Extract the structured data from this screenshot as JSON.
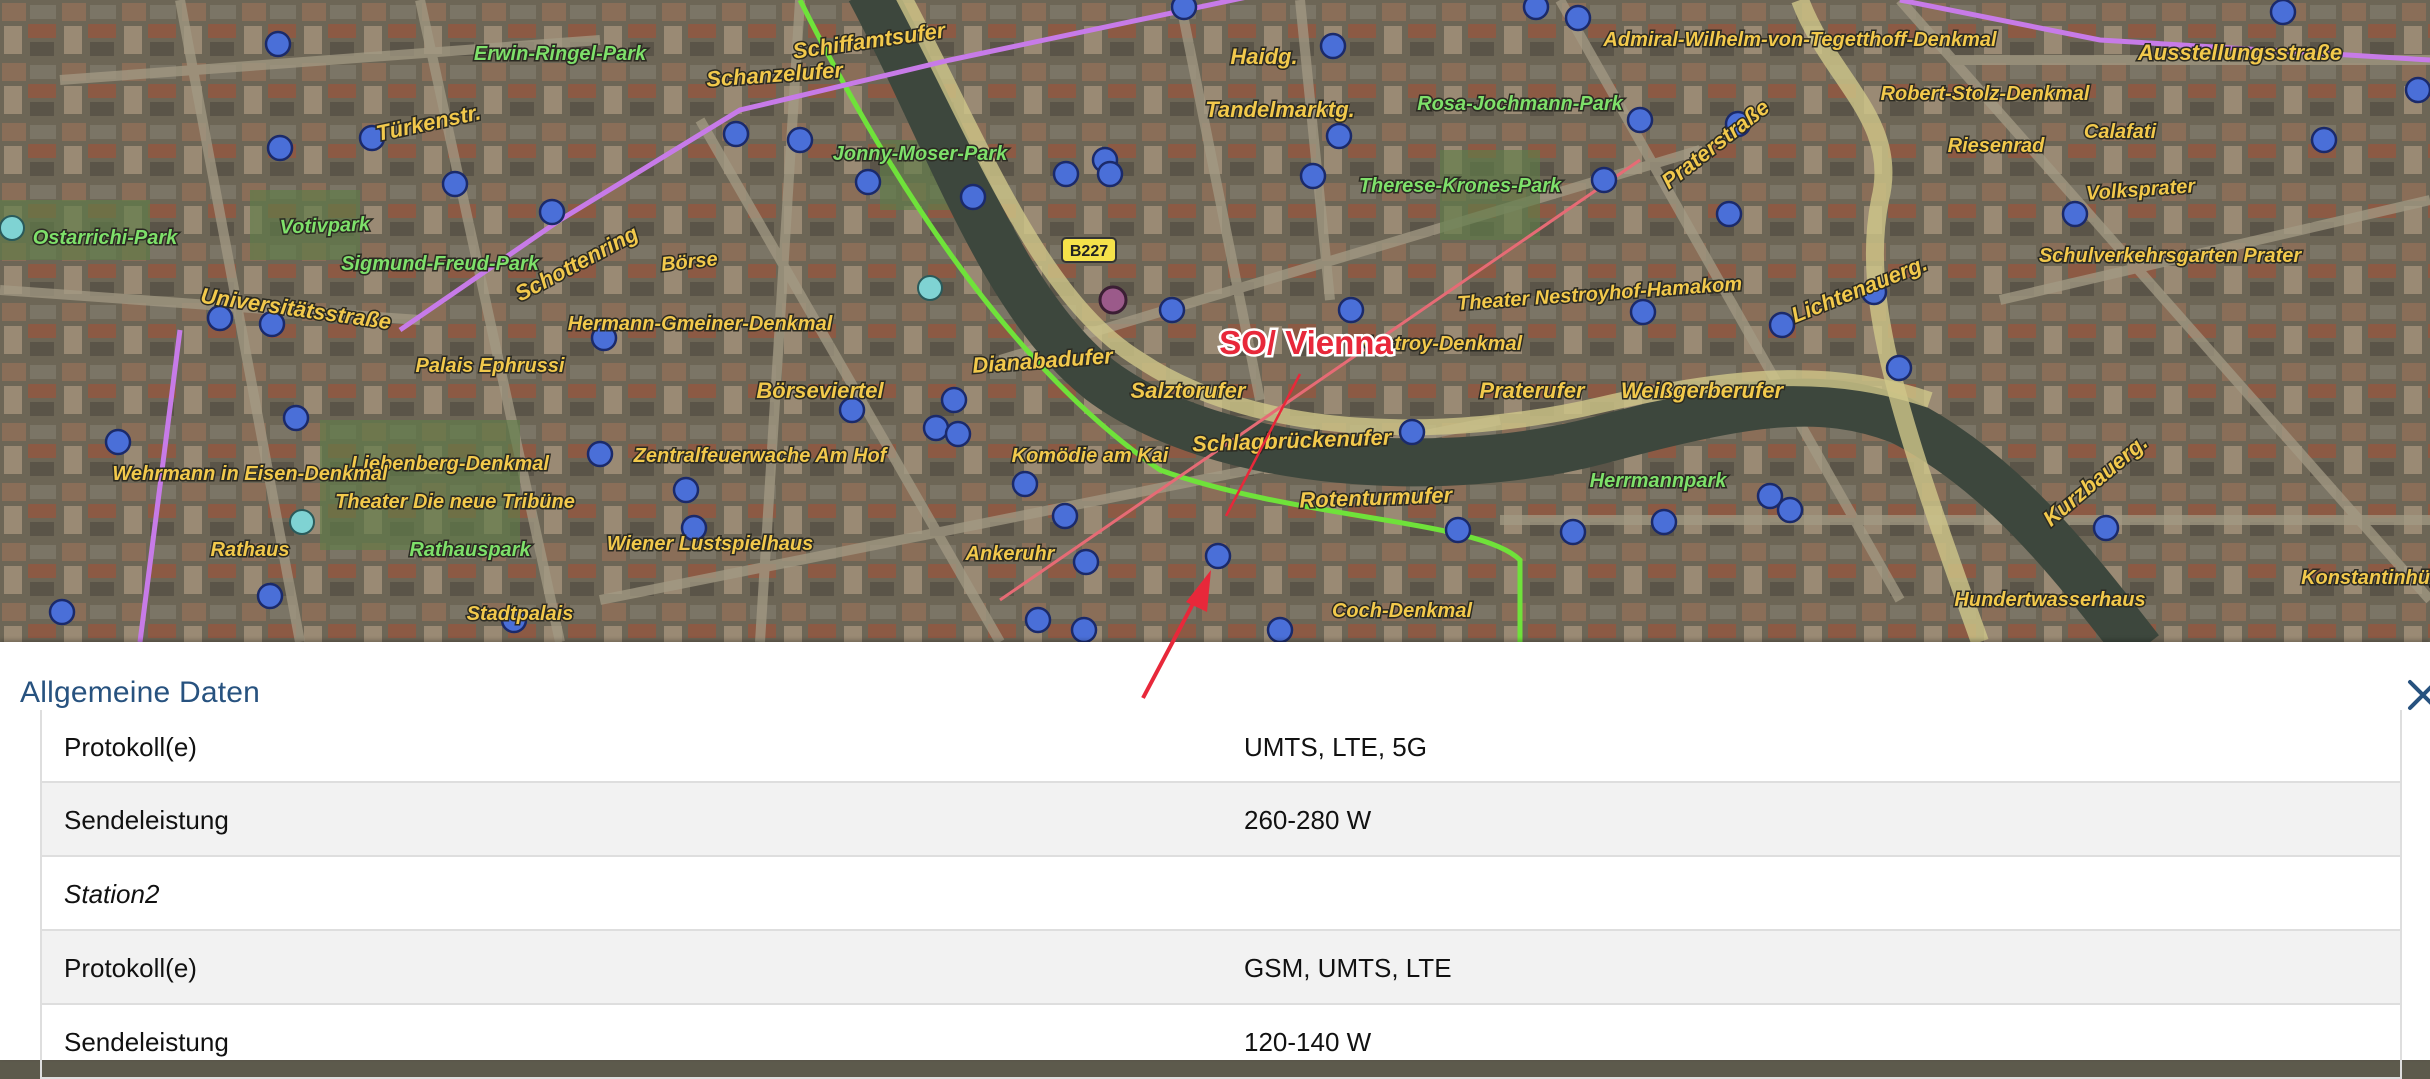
{
  "map": {
    "callout_label": "SO/ Vienna",
    "road_shield": "B227",
    "labels": [
      {
        "text": "Schiffamtsufer",
        "kind": "street"
      },
      {
        "text": "Schanzelufer",
        "kind": "street"
      },
      {
        "text": "Erwin-Ringel-Park",
        "kind": "park"
      },
      {
        "text": "Türkenstr.",
        "kind": "street"
      },
      {
        "text": "Votivpark",
        "kind": "park"
      },
      {
        "text": "Ostarrichi-Park",
        "kind": "park"
      },
      {
        "text": "Universitätsstraße",
        "kind": "street"
      },
      {
        "text": "Sigmund-Freud-Park",
        "kind": "park"
      },
      {
        "text": "Schottenring",
        "kind": "street"
      },
      {
        "text": "Börse",
        "kind": "poi"
      },
      {
        "text": "Hermann-Gmeiner-Denkmal",
        "kind": "poi"
      },
      {
        "text": "Jonny-Moser-Park",
        "kind": "park"
      },
      {
        "text": "Palais Ephrussi",
        "kind": "poi"
      },
      {
        "text": "Liebenberg-Denkmal",
        "kind": "poi"
      },
      {
        "text": "Wehrmann in Eisen-Denkmal",
        "kind": "poi"
      },
      {
        "text": "Theater Die neue Tribüne",
        "kind": "poi"
      },
      {
        "text": "Rathauspark",
        "kind": "park"
      },
      {
        "text": "Rathaus",
        "kind": "poi"
      },
      {
        "text": "Stadtpalais",
        "kind": "poi"
      },
      {
        "text": "Zentralfeuerwache Am Hof",
        "kind": "poi"
      },
      {
        "text": "Wiener Lustspielhaus",
        "kind": "poi"
      },
      {
        "text": "Börseviertel",
        "kind": "street"
      },
      {
        "text": "Dianabadufer",
        "kind": "street"
      },
      {
        "text": "Salztorufer",
        "kind": "street"
      },
      {
        "text": "Komödie am Kai",
        "kind": "poi"
      },
      {
        "text": "Ankeruhr",
        "kind": "poi"
      },
      {
        "text": "Schlagbrückenufer",
        "kind": "street"
      },
      {
        "text": "Rotenturmufer",
        "kind": "street"
      },
      {
        "text": "Coch-Denkmal",
        "kind": "poi"
      },
      {
        "text": "Nestroy-Denkmal",
        "kind": "poi"
      },
      {
        "text": "Tandelmarktg.",
        "kind": "street"
      },
      {
        "text": "Haidg.",
        "kind": "street"
      },
      {
        "text": "Rosa-Jochmann-Park",
        "kind": "park"
      },
      {
        "text": "Therese-Krones-Park",
        "kind": "park"
      },
      {
        "text": "Theater Nestroyhof-Hamakom",
        "kind": "poi"
      },
      {
        "text": "Praterstraße",
        "kind": "street"
      },
      {
        "text": "Praterufer",
        "kind": "street"
      },
      {
        "text": "Weißgerberufer",
        "kind": "street"
      },
      {
        "text": "Herrmannpark",
        "kind": "park"
      },
      {
        "text": "Admiral-Wilhelm-von-Tegetthoff-Denkmal",
        "kind": "poi"
      },
      {
        "text": "Robert-Stolz-Denkmal",
        "kind": "poi"
      },
      {
        "text": "Riesenrad",
        "kind": "poi"
      },
      {
        "text": "Calafati",
        "kind": "poi"
      },
      {
        "text": "Volksprater",
        "kind": "poi"
      },
      {
        "text": "Schulverkehrsgarten Prater",
        "kind": "poi"
      },
      {
        "text": "Ausstellungsstraße",
        "kind": "street"
      },
      {
        "text": "Hundertwasserhaus",
        "kind": "poi"
      },
      {
        "text": "Konstantinhügel",
        "kind": "poi"
      },
      {
        "text": "Lichtenauerg.",
        "kind": "street"
      },
      {
        "text": "Kurzbauerg.",
        "kind": "street"
      }
    ]
  },
  "panel": {
    "title": "Allgemeine Daten",
    "rows": [
      {
        "label": "Protokoll(e)",
        "value": "UMTS, LTE, 5G"
      },
      {
        "label": "Sendeleistung",
        "value": "260-280 W"
      },
      {
        "label": "Station2",
        "value": ""
      },
      {
        "label": "Protokoll(e)",
        "value": "GSM, UMTS, LTE"
      },
      {
        "label": "Sendeleistung",
        "value": "120-140 W"
      }
    ]
  },
  "colors": {
    "title": "#27527f",
    "station_marker": "#4a6fd8",
    "selected_marker": "#9b5a8a",
    "annotation": "#e8283a",
    "street_label": "#f2c94c",
    "park_label": "#7ee06a",
    "tram_line": "#6fe23a",
    "metro_line": "#c77be8"
  }
}
